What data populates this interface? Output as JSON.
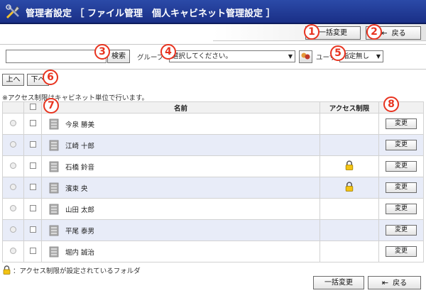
{
  "header": {
    "title": "管理者設定 ［ ファイル管理　個人キャビネット管理設定 ］"
  },
  "toolbar_top": {
    "bulk_change": "一括変更",
    "back": "戻る"
  },
  "search": {
    "input_value": "",
    "search_button": "検索",
    "group_label": "グループ",
    "group_select": "選択してください。",
    "user_label": "ユーザ",
    "user_select": "指定無し"
  },
  "sort": {
    "up": "上へ",
    "down": "下へ"
  },
  "note": "※アクセス制限はキャビネット単位で行います。",
  "table": {
    "headers": {
      "name": "名前",
      "access": "アクセス制限"
    },
    "change_label": "変更",
    "rows": [
      {
        "name": "今泉 勝美",
        "locked": false
      },
      {
        "name": "江崎 十郎",
        "locked": false
      },
      {
        "name": "石橋 鈴音",
        "locked": true
      },
      {
        "name": "濱束 央",
        "locked": true
      },
      {
        "name": "山田 太郎",
        "locked": false
      },
      {
        "name": "平尾 泰男",
        "locked": false
      },
      {
        "name": "堀内 誠治",
        "locked": false
      }
    ]
  },
  "legend": "：アクセス制限が設定されているフォルダ",
  "toolbar_bottom": {
    "bulk_change": "一括変更",
    "back": "戻る"
  },
  "markers": [
    "1",
    "2",
    "3",
    "4",
    "5",
    "6",
    "7",
    "8"
  ],
  "colors": {
    "titlebar": "#1f3a9a",
    "row_alt": "#e8ecf8",
    "marker": "#e8331f"
  }
}
